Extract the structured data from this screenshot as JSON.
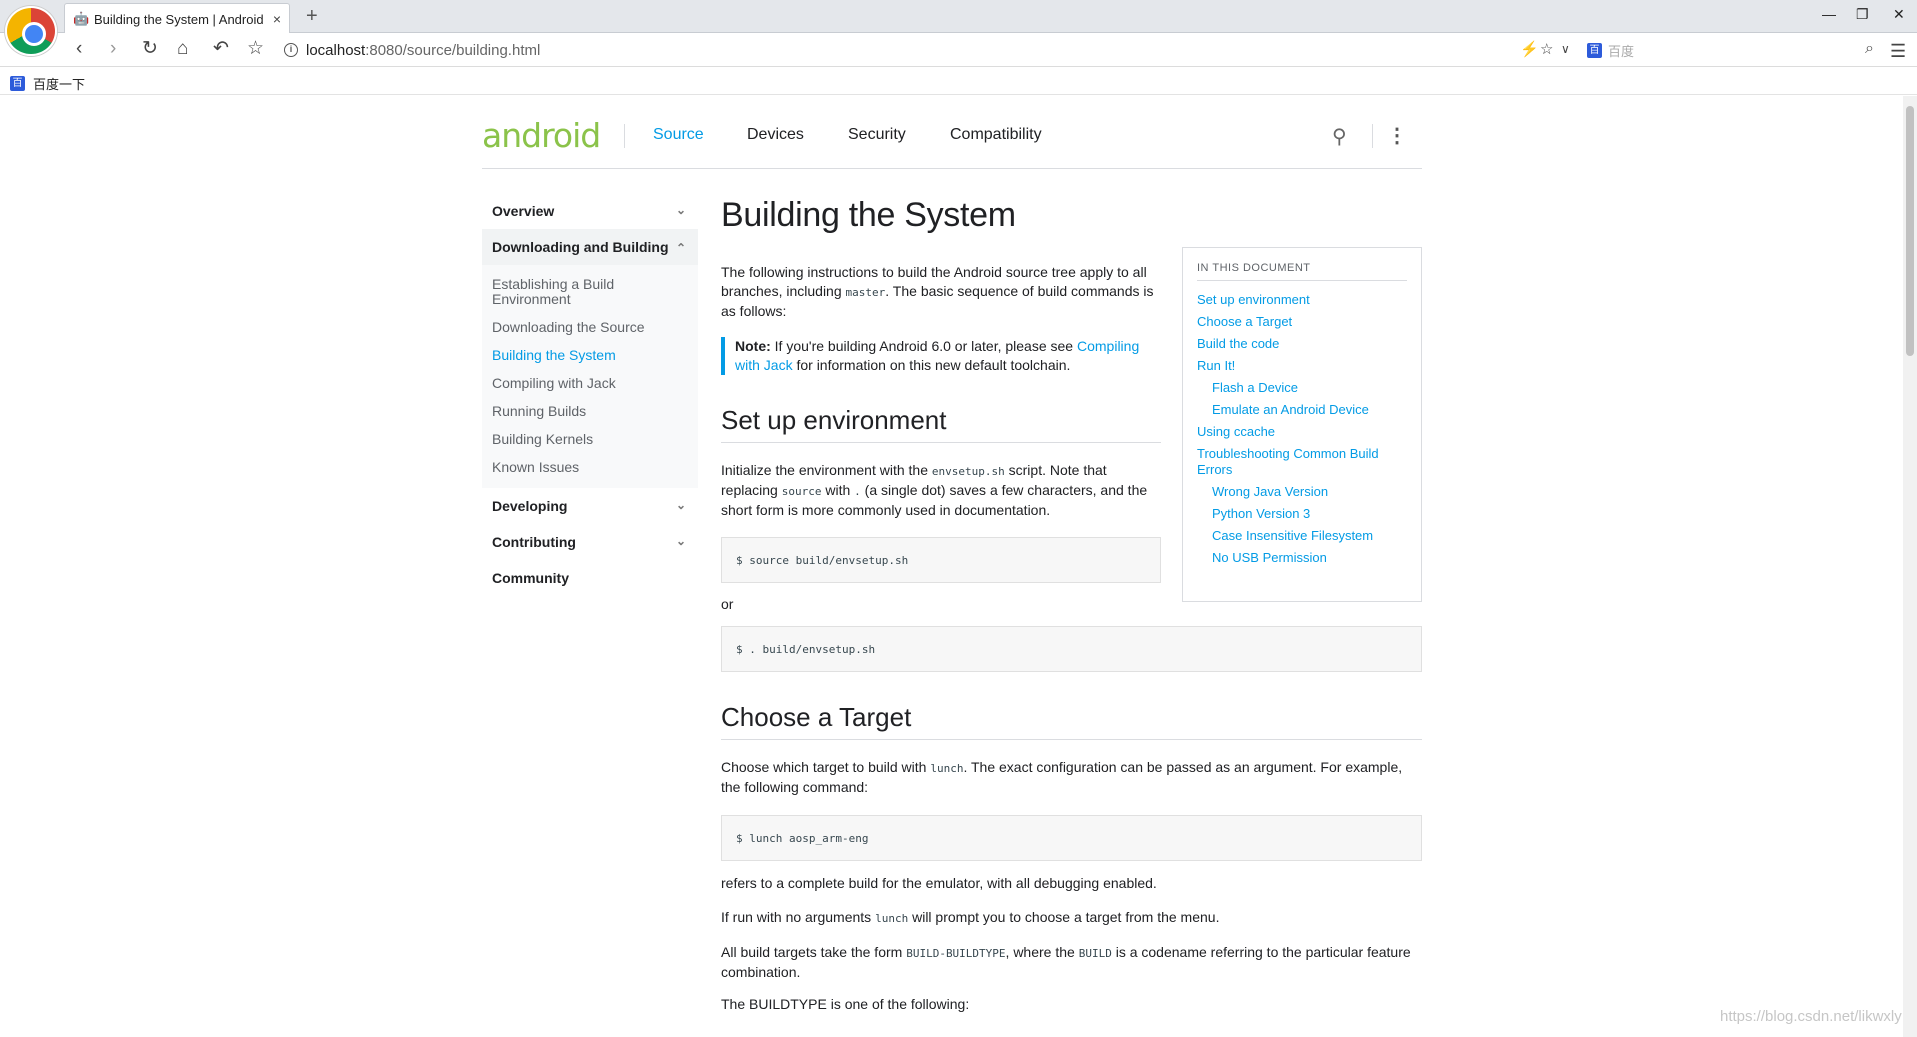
{
  "browser": {
    "tab_title": "Building the System | Android",
    "tab_close": "×",
    "new_tab": "+",
    "url_host": "localhost",
    "url_path": ":8080/source/building.html",
    "search_placeholder": "百度",
    "bookmark_label": "百度一下",
    "window_minimize": "—",
    "window_restore": "❐",
    "window_close": "✕"
  },
  "site": {
    "logo": "android",
    "nav": [
      "Source",
      "Devices",
      "Security",
      "Compatibility"
    ]
  },
  "sidebar": {
    "sections": [
      {
        "label": "Overview"
      },
      {
        "label": "Downloading and Building"
      },
      {
        "label": "Developing"
      },
      {
        "label": "Contributing"
      },
      {
        "label": "Community"
      }
    ],
    "sub_items": [
      "Establishing a Build Environment",
      "Downloading the Source",
      "Building the System",
      "Compiling with Jack",
      "Running Builds",
      "Building Kernels",
      "Known Issues"
    ]
  },
  "main": {
    "title": "Building the System",
    "intro_a": "The following instructions to build the Android source tree apply to all branches, including ",
    "intro_code": "master",
    "intro_b": ". The basic sequence of build commands is as follows:",
    "note_label": "Note:",
    "note_a": " If you're building Android 6.0 or later, please see ",
    "note_link": "Compiling with Jack",
    "note_b": " for information on this new default toolchain.",
    "setup_heading": "Set up environment",
    "setup_a": "Initialize the environment with the ",
    "setup_code1": "envsetup.sh",
    "setup_b": " script. Note that replacing ",
    "setup_code2": "source",
    "setup_c": " with ",
    "setup_code3": ".",
    "setup_d": " (a single dot) saves a few characters, and the short form is more commonly used in documentation.",
    "code1": "$ source build/envsetup.sh",
    "or": "or",
    "code2": "$ . build/envsetup.sh",
    "target_heading": "Choose a Target",
    "target_a": "Choose which target to build with ",
    "target_code": "lunch",
    "target_b": ". The exact configuration can be passed as an argument. For example, the following command:",
    "code3": "$ lunch aosp_arm-eng",
    "p_refers": "refers to a complete build for the emulator, with all debugging enabled.",
    "p_run_a": "If run with no arguments ",
    "p_run_code": "lunch",
    "p_run_b": " will prompt you to choose a target from the menu.",
    "p_all_a": "All build targets take the form ",
    "p_all_code1": "BUILD-BUILDTYPE",
    "p_all_b": ", where the ",
    "p_all_code2": "BUILD",
    "p_all_c": " is a codename referring to the particular feature combination.",
    "p_buildtype": "The BUILDTYPE is one of the following:"
  },
  "toc": {
    "title": "IN THIS DOCUMENT",
    "items": [
      {
        "label": "Set up environment",
        "sub": false
      },
      {
        "label": "Choose a Target",
        "sub": false
      },
      {
        "label": "Build the code",
        "sub": false
      },
      {
        "label": "Run It!",
        "sub": false
      },
      {
        "label": "Flash a Device",
        "sub": true
      },
      {
        "label": "Emulate an Android Device",
        "sub": true
      },
      {
        "label": "Using ccache",
        "sub": false
      },
      {
        "label": "Troubleshooting Common Build Errors",
        "sub": false
      },
      {
        "label": "Wrong Java Version",
        "sub": true
      },
      {
        "label": "Python Version 3",
        "sub": true
      },
      {
        "label": "Case Insensitive Filesystem",
        "sub": true
      },
      {
        "label": "No USB Permission",
        "sub": true
      }
    ]
  },
  "watermark": "https://blog.csdn.net/likwxly",
  "colors": {
    "accent": "#039be5",
    "android_green": "#8bc34a"
  }
}
